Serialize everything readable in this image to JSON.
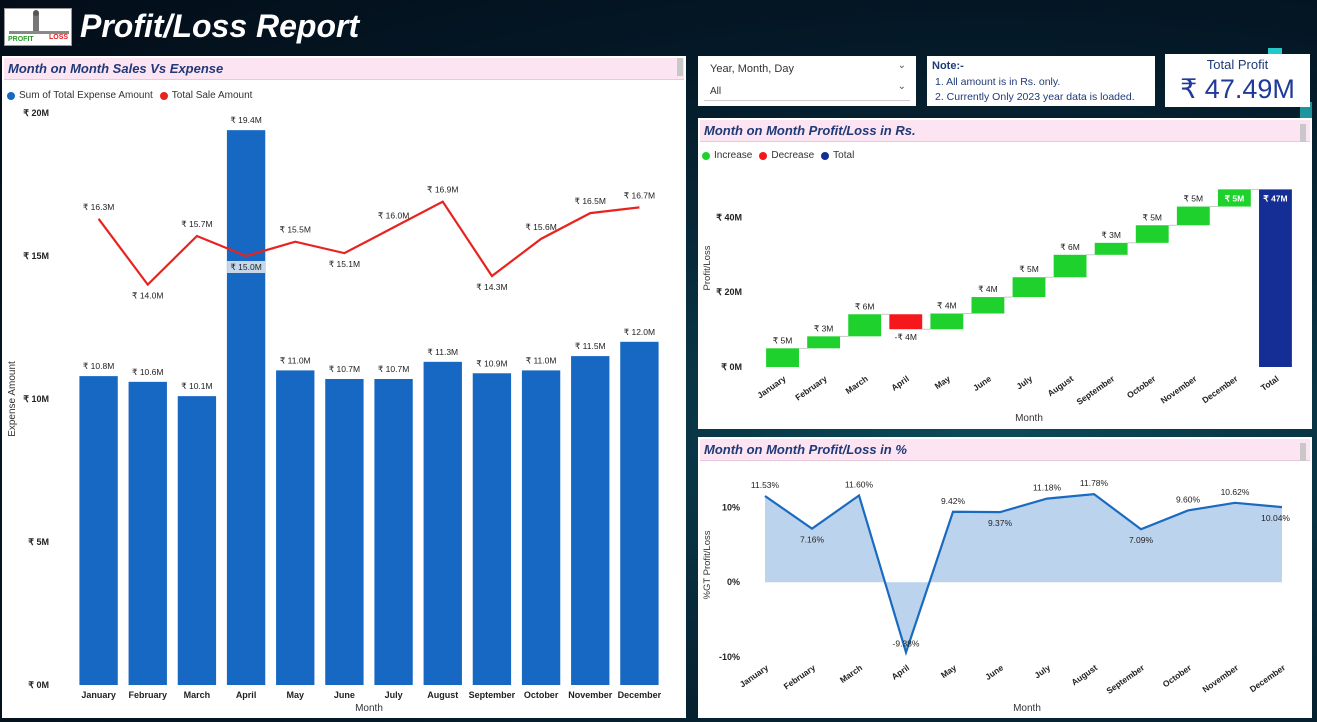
{
  "app": {
    "title": "Profit/Loss Report",
    "logo_text_left": "PROFIT",
    "logo_text_right": "LOSS"
  },
  "slicer": {
    "label": "Year, Month, Day",
    "value": "All"
  },
  "note": {
    "title": "Note:-",
    "lines": [
      "1. All amount is in Rs. only.",
      "2. Currently Only  2023 year data is loaded."
    ]
  },
  "kpi": {
    "label": "Total Profit",
    "value": "₹ 47.49M"
  },
  "panels": {
    "sales_expense": "Month on Month Sales Vs Expense",
    "waterfall": "Month on Month Profit/Loss in Rs.",
    "percent": "Month on Month Profit/Loss in %"
  },
  "colors": {
    "expense_bar": "#1768c2",
    "sale_line": "#e8231f",
    "increase": "#1ed12c",
    "decrease": "#f5171c",
    "total": "#142e96",
    "area_fill": "#bcd3ee",
    "area_line": "#1a6bbf"
  },
  "chart_data": [
    {
      "type": "bar",
      "title": "Month on Month Sales Vs Expense",
      "xlabel": "Month",
      "ylabel": "Expense Amount",
      "ylim": [
        0,
        20
      ],
      "yticks": [
        {
          "v": 0,
          "label": "₹ 0M"
        },
        {
          "v": 5,
          "label": "₹ 5M"
        },
        {
          "v": 10,
          "label": "₹ 10M"
        },
        {
          "v": 15,
          "label": "₹ 15M"
        },
        {
          "v": 20,
          "label": "₹ 20M"
        }
      ],
      "legend_position": "top-left",
      "categories": [
        "January",
        "February",
        "March",
        "April",
        "May",
        "June",
        "July",
        "August",
        "September",
        "October",
        "November",
        "December"
      ],
      "series": [
        {
          "name": "Sum of Total Expense Amount",
          "kind": "bar",
          "values": [
            10.8,
            10.6,
            10.1,
            19.4,
            11.0,
            10.7,
            10.7,
            11.3,
            10.9,
            11.0,
            11.5,
            12.0
          ],
          "labels": [
            "₹ 10.8M",
            "₹ 10.6M",
            "₹ 10.1M",
            "₹ 19.4M",
            "₹ 11.0M",
            "₹ 10.7M",
            "₹ 10.7M",
            "₹ 11.3M",
            "₹ 10.9M",
            "₹ 11.0M",
            "₹ 11.5M",
            "₹ 12.0M"
          ]
        },
        {
          "name": "Total Sale Amount",
          "kind": "line",
          "values": [
            16.3,
            14.0,
            15.7,
            15.0,
            15.5,
            15.1,
            16.0,
            16.9,
            14.3,
            15.6,
            16.5,
            16.7
          ],
          "labels": [
            "₹ 16.3M",
            "₹ 14.0M",
            "₹ 15.7M",
            "₹ 15.0M",
            "₹ 15.5M",
            "₹ 15.1M",
            "₹ 16.0M",
            "₹ 16.9M",
            "₹ 14.3M",
            "₹ 15.6M",
            "₹ 16.5M",
            "₹ 16.7M"
          ]
        }
      ]
    },
    {
      "type": "bar",
      "subtype": "waterfall",
      "title": "Month on Month Profit/Loss in Rs.",
      "xlabel": "Month",
      "ylabel": "Profit/Loss",
      "ylim": [
        0,
        50
      ],
      "yticks": [
        {
          "v": 0,
          "label": "₹ 0M"
        },
        {
          "v": 20,
          "label": "₹ 20M"
        },
        {
          "v": 40,
          "label": "₹ 40M"
        }
      ],
      "legend": [
        "Increase",
        "Decrease",
        "Total"
      ],
      "legend_position": "top-left",
      "categories": [
        "January",
        "February",
        "March",
        "April",
        "May",
        "June",
        "July",
        "August",
        "September",
        "October",
        "November",
        "December",
        "Total"
      ],
      "values": [
        5.0,
        3.2,
        5.9,
        -4.0,
        4.2,
        4.4,
        5.3,
        6.0,
        3.2,
        4.7,
        5.0,
        4.6,
        47.49
      ],
      "labels": [
        "₹ 5M",
        "₹ 3M",
        "₹ 6M",
        "-₹ 4M",
        "₹ 4M",
        "₹ 4M",
        "₹ 5M",
        "₹ 6M",
        "₹ 3M",
        "₹ 5M",
        "₹ 5M",
        "₹ 5M",
        "₹ 47M"
      ]
    },
    {
      "type": "area",
      "title": "Month on Month Profit/Loss in %",
      "xlabel": "Month",
      "ylabel": "%GT Profit/Loss",
      "ylim": [
        -10,
        13
      ],
      "yticks": [
        {
          "v": -10,
          "label": "-10%"
        },
        {
          "v": 0,
          "label": "0%"
        },
        {
          "v": 10,
          "label": "10%"
        }
      ],
      "categories": [
        "January",
        "February",
        "March",
        "April",
        "May",
        "June",
        "July",
        "August",
        "September",
        "October",
        "November",
        "December"
      ],
      "values": [
        11.53,
        7.16,
        11.6,
        -9.38,
        9.42,
        9.37,
        11.18,
        11.78,
        7.09,
        9.6,
        10.62,
        10.04
      ],
      "labels": [
        "11.53%",
        "7.16%",
        "11.60%",
        "-9.38%",
        "9.42%",
        "9.37%",
        "11.18%",
        "11.78%",
        "7.09%",
        "9.60%",
        "10.62%",
        "10.04%"
      ]
    }
  ]
}
